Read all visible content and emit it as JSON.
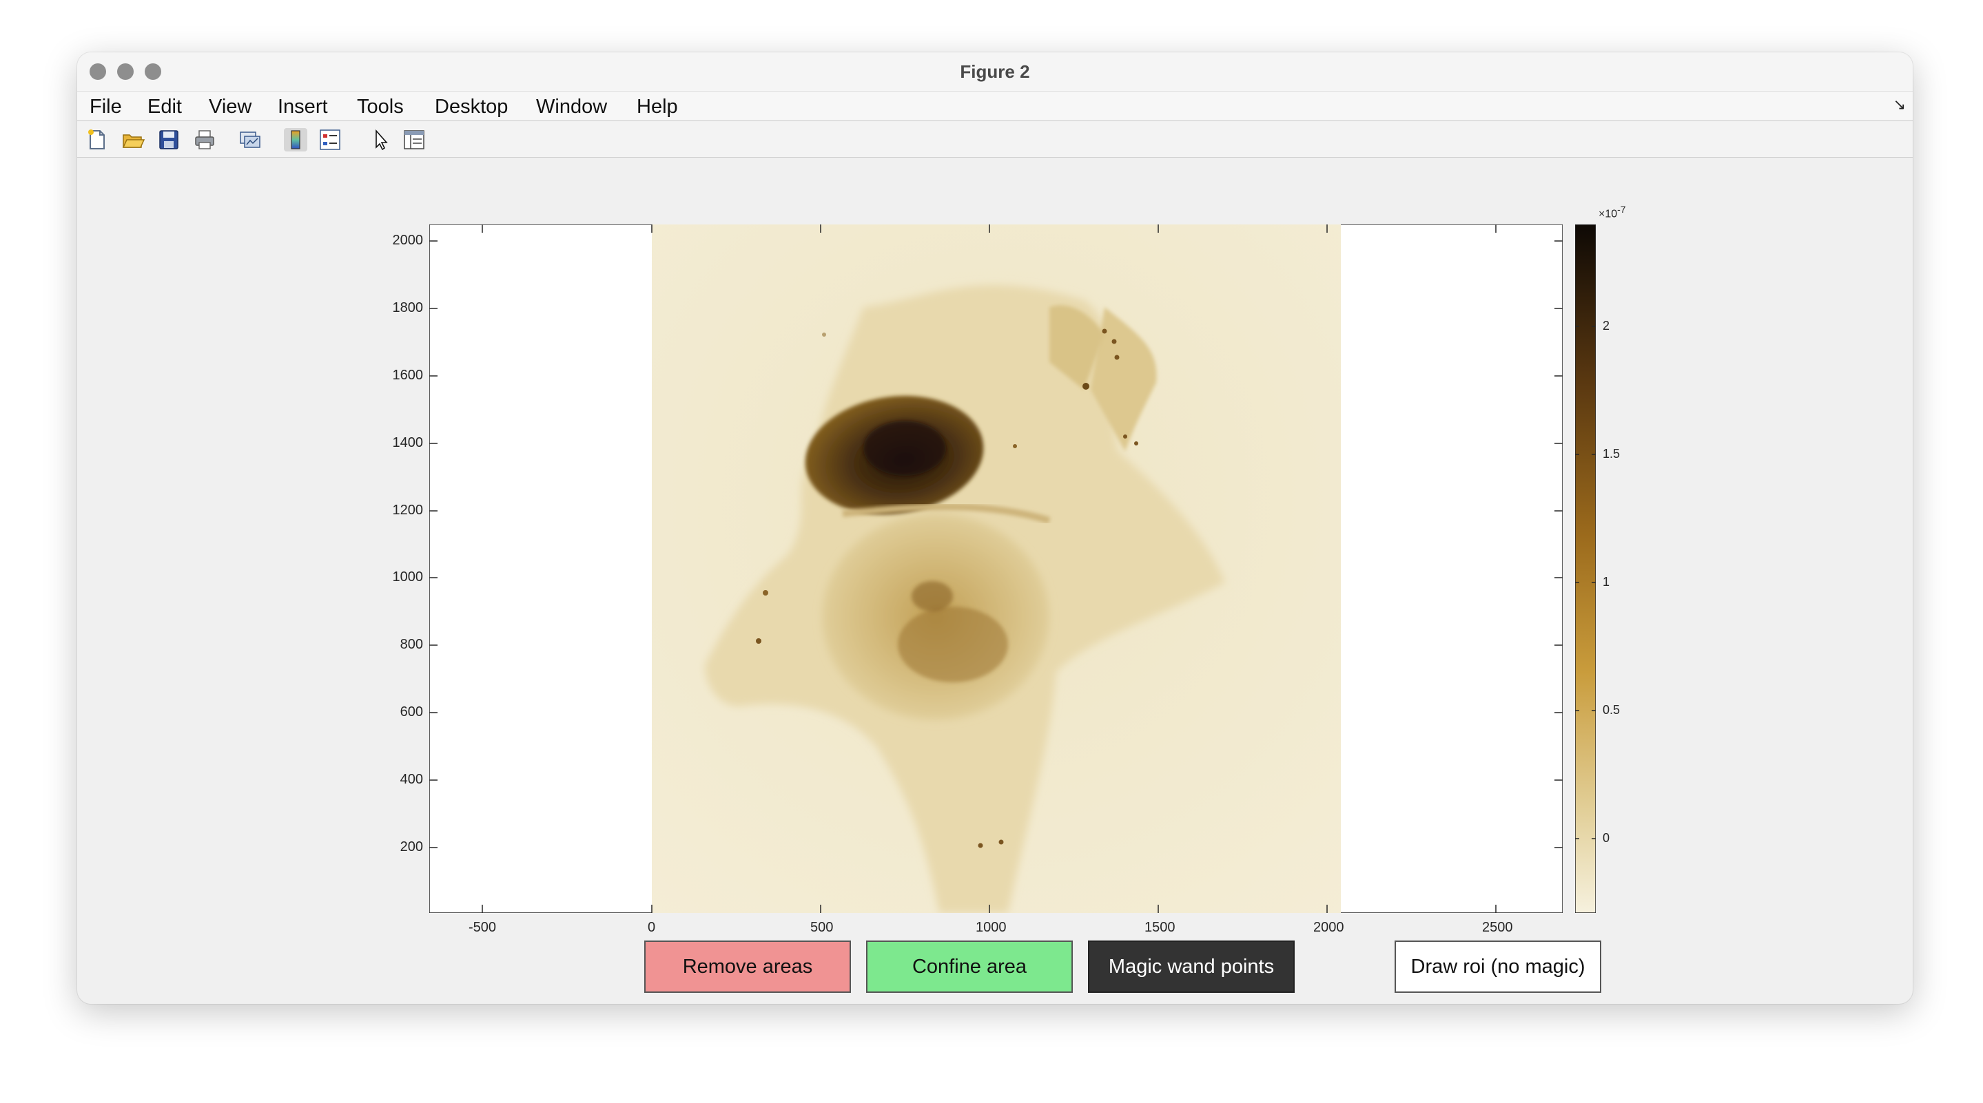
{
  "window": {
    "title": "Figure 2"
  },
  "menu": {
    "items": [
      "File",
      "Edit",
      "View",
      "Insert",
      "Tools",
      "Desktop",
      "Window",
      "Help"
    ]
  },
  "toolbar": {
    "icons": [
      "new-figure-icon",
      "open-file-icon",
      "save-icon",
      "print-icon",
      "link-plot-icon",
      "colorbar-icon",
      "legend-icon",
      "pointer-icon",
      "property-inspector-icon"
    ]
  },
  "axes": {
    "x_ticks": [
      "-500",
      "0",
      "500",
      "1000",
      "1500",
      "2000",
      "2500"
    ],
    "y_ticks": [
      "2000",
      "1800",
      "1600",
      "1400",
      "1200",
      "1000",
      "800",
      "600",
      "400",
      "200"
    ]
  },
  "colorbar": {
    "exponent_base": "×10",
    "exponent_power": "-7",
    "ticks": [
      "2",
      "1.5",
      "1",
      "0.5",
      "0"
    ]
  },
  "buttons": {
    "remove": "Remove areas",
    "confine": "Confine area",
    "magic": "Magic wand points",
    "draw": "Draw roi (no magic)"
  },
  "colors": {
    "remove_bg": "#f09393",
    "confine_bg": "#7de88e",
    "magic_bg": "#333333",
    "draw_bg": "#ffffff",
    "image_light": "#f1ead0",
    "image_dark": "#1c1208"
  }
}
